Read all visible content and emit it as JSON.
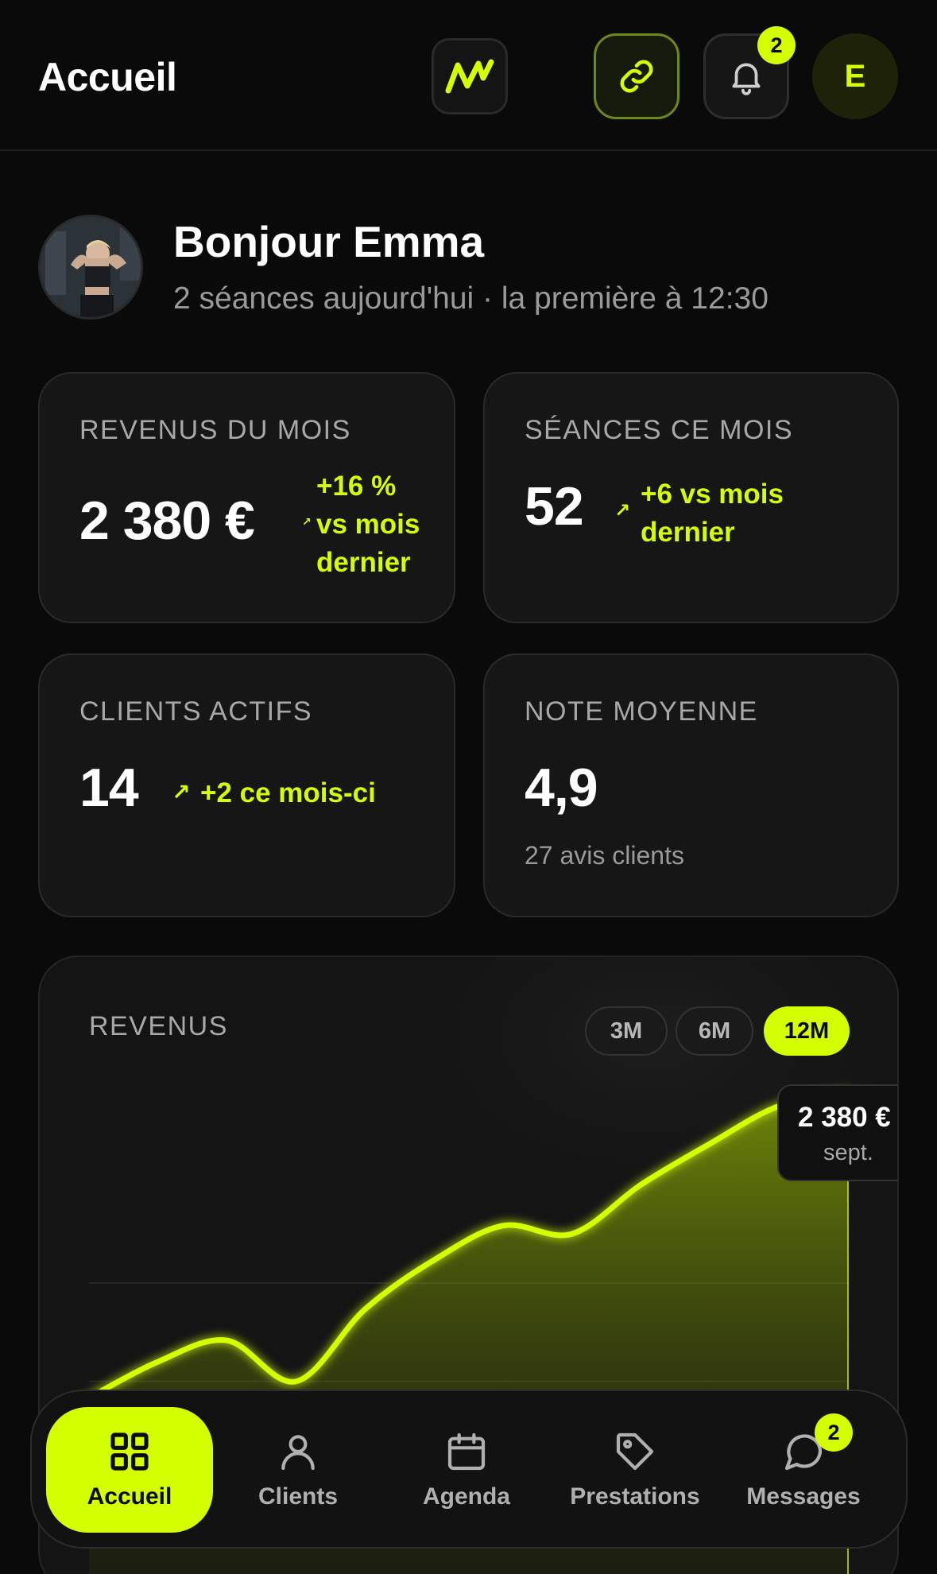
{
  "header": {
    "title": "Accueil",
    "notifications_count": "2",
    "avatar_initial": "E"
  },
  "greeting": {
    "title": "Bonjour Emma",
    "subtitle": "2 séances aujourd'hui · la première à 12:30"
  },
  "stats": [
    {
      "label": "REVENUS DU MOIS",
      "value": "2 380 €",
      "delta_line1": "+16 %",
      "delta_line2": "vs mois",
      "delta_line3": "dernier"
    },
    {
      "label": "SÉANCES CE MOIS",
      "value": "52",
      "delta_line1": "+6 vs mois",
      "delta_line2": "dernier"
    },
    {
      "label": "CLIENTS ACTIFS",
      "value": "14",
      "delta_line1": "+2 ce mois-ci"
    },
    {
      "label": "NOTE MOYENNE",
      "value": "4,9",
      "sub": "27 avis clients"
    }
  ],
  "revenue_chart": {
    "label": "REVENUS",
    "ranges": [
      "3M",
      "6M",
      "12M"
    ],
    "selected_range": "12M",
    "tooltip_value": "2 380 €",
    "tooltip_month": "sept."
  },
  "chart_data": {
    "type": "area",
    "title": "REVENUS",
    "x": [
      1,
      2,
      3,
      4,
      5,
      6,
      7,
      8,
      9,
      10,
      11,
      12
    ],
    "values": [
      1450,
      1560,
      1625,
      1500,
      1720,
      1870,
      1975,
      1950,
      2100,
      2225,
      2340,
      2380
    ],
    "last_label": "sept.",
    "grid": true,
    "color": "#d4ff00"
  },
  "nav": {
    "items": [
      {
        "label": "Accueil",
        "icon": "grid-icon",
        "active": true
      },
      {
        "label": "Clients",
        "icon": "user-icon",
        "active": false
      },
      {
        "label": "Agenda",
        "icon": "calendar-icon",
        "active": false
      },
      {
        "label": "Prestations",
        "icon": "tag-icon",
        "active": false
      },
      {
        "label": "Messages",
        "icon": "chat-icon",
        "active": false
      }
    ],
    "messages_count": "2"
  },
  "colors": {
    "accent": "#d4ff00",
    "background": "#0a0a0a",
    "card": "#161616"
  }
}
